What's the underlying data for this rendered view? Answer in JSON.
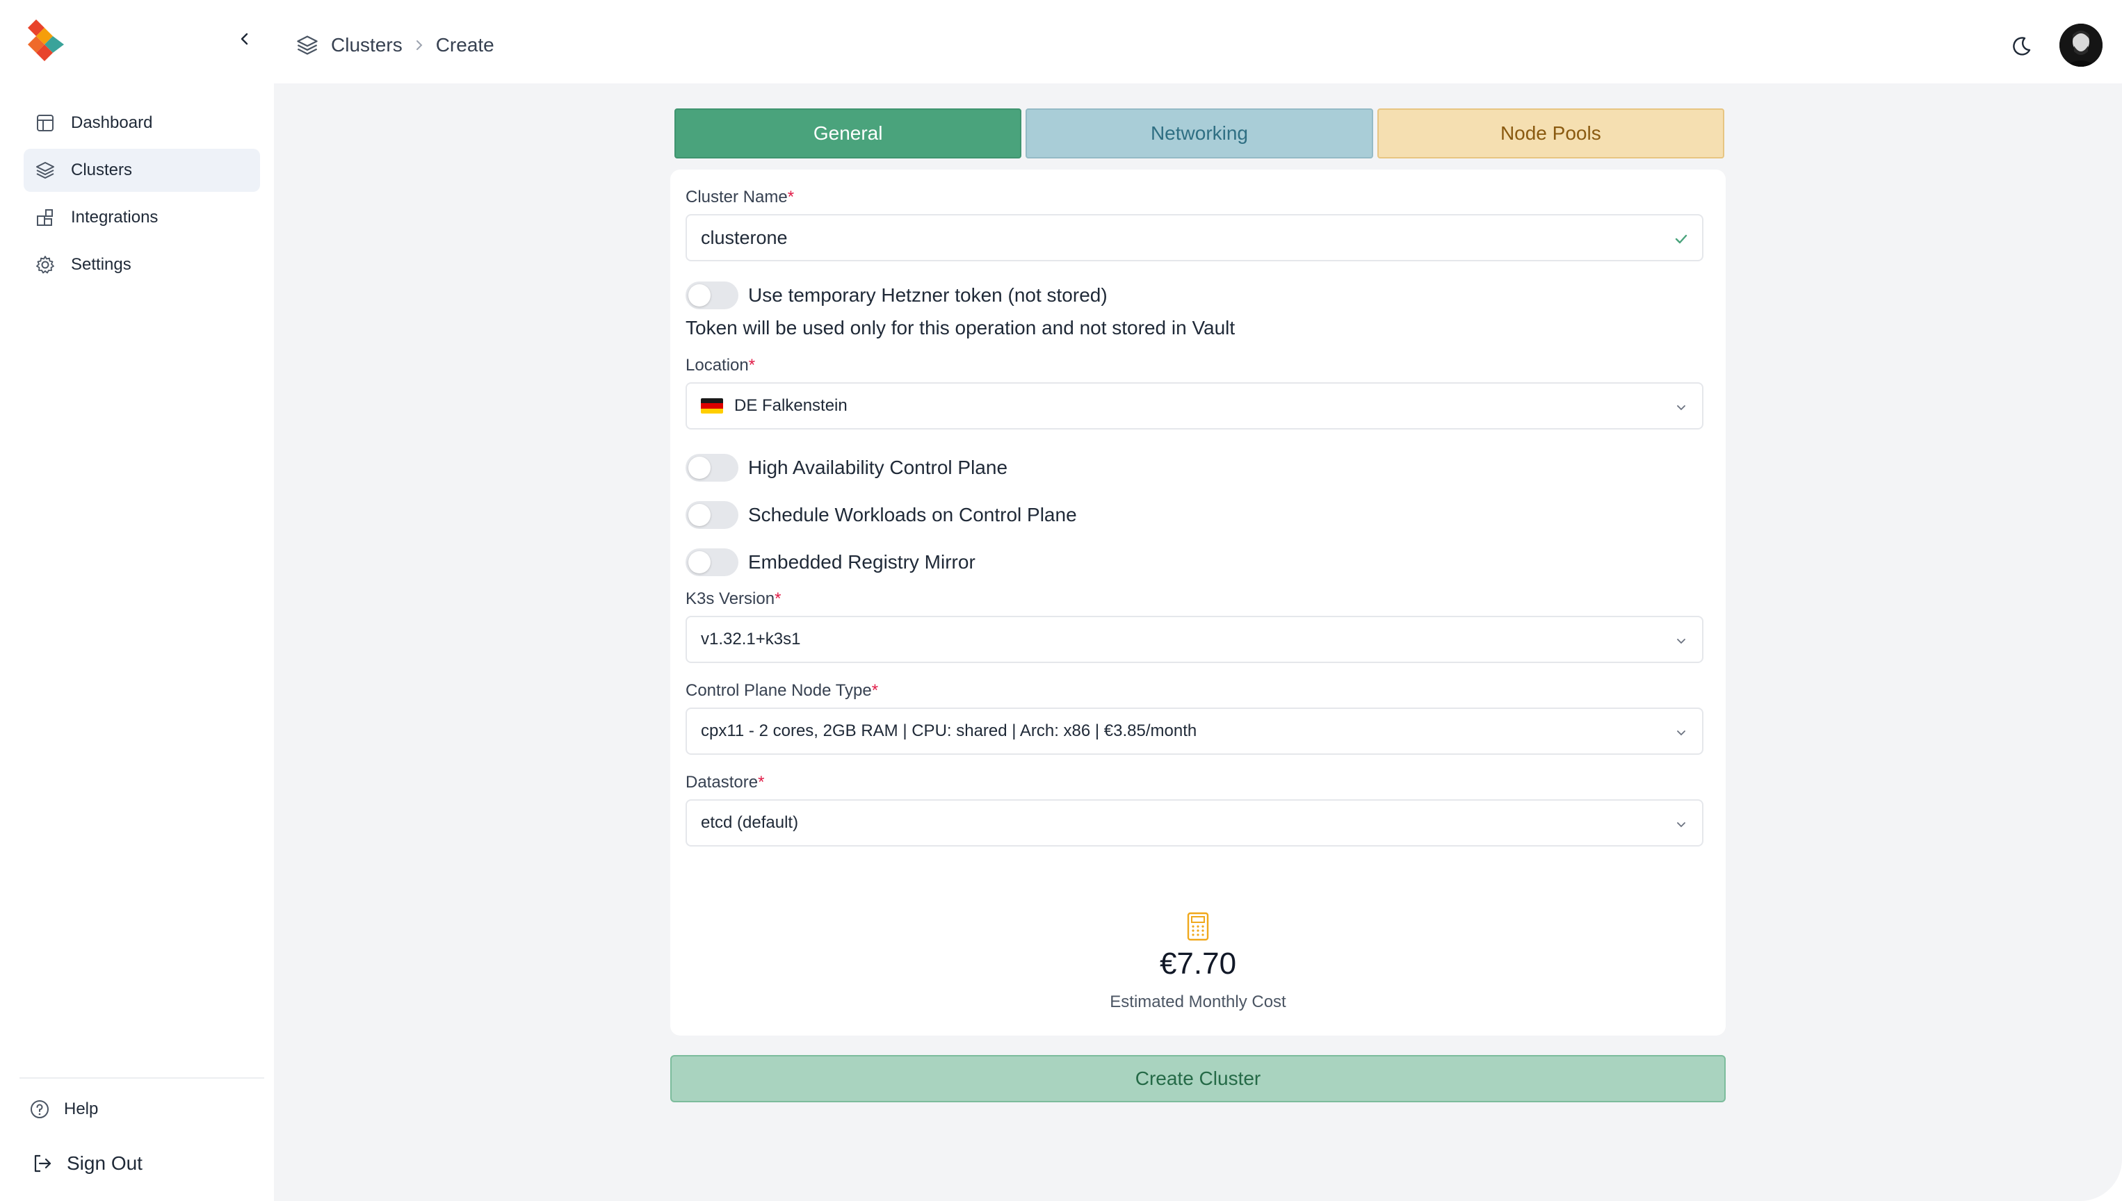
{
  "sidebar": {
    "logo_icon": "app-logo",
    "collapse_icon": "chevron-left-icon",
    "items": [
      {
        "label": "Dashboard",
        "icon": "dashboard-icon",
        "active": false
      },
      {
        "label": "Clusters",
        "icon": "layers-icon",
        "active": true
      },
      {
        "label": "Integrations",
        "icon": "integrations-icon",
        "active": false
      },
      {
        "label": "Settings",
        "icon": "gear-icon",
        "active": false
      }
    ],
    "help_label": "Help",
    "signout_label": "Sign Out"
  },
  "header": {
    "breadcrumb": [
      "Clusters",
      "Create"
    ],
    "theme_icon": "moon-icon",
    "avatar": "user-avatar"
  },
  "tabs": [
    {
      "label": "General",
      "color": "#4aa37c"
    },
    {
      "label": "Networking",
      "color": "#a9cdd7"
    },
    {
      "label": "Node Pools",
      "color": "#f5dfb1"
    }
  ],
  "form": {
    "cluster_name": {
      "label": "Cluster Name",
      "required": "*",
      "value": "clusterone"
    },
    "temp_token": {
      "label": "Use temporary Hetzner token (not stored)",
      "enabled": false,
      "hint": "Token will be used only for this operation and not stored in Vault"
    },
    "location": {
      "label": "Location",
      "required": "*",
      "value": "DE Falkenstein"
    },
    "ha_control_plane": {
      "label": "High Availability Control Plane",
      "enabled": false
    },
    "schedule_workloads": {
      "label": "Schedule Workloads on Control Plane",
      "enabled": false
    },
    "registry_mirror": {
      "label": "Embedded Registry Mirror",
      "enabled": false
    },
    "k3s_version": {
      "label": "K3s Version",
      "required": "*",
      "value": "v1.32.1+k3s1"
    },
    "control_plane_type": {
      "label": "Control Plane Node Type",
      "required": "*",
      "value": "cpx11 - 2 cores, 2GB RAM | CPU: shared | Arch: x86 | €3.85/month"
    },
    "datastore": {
      "label": "Datastore",
      "required": "*",
      "value": "etcd (default)"
    }
  },
  "cost": {
    "icon": "calculator-icon",
    "value": "€7.70",
    "label": "Estimated Monthly Cost"
  },
  "create_button": "Create Cluster"
}
